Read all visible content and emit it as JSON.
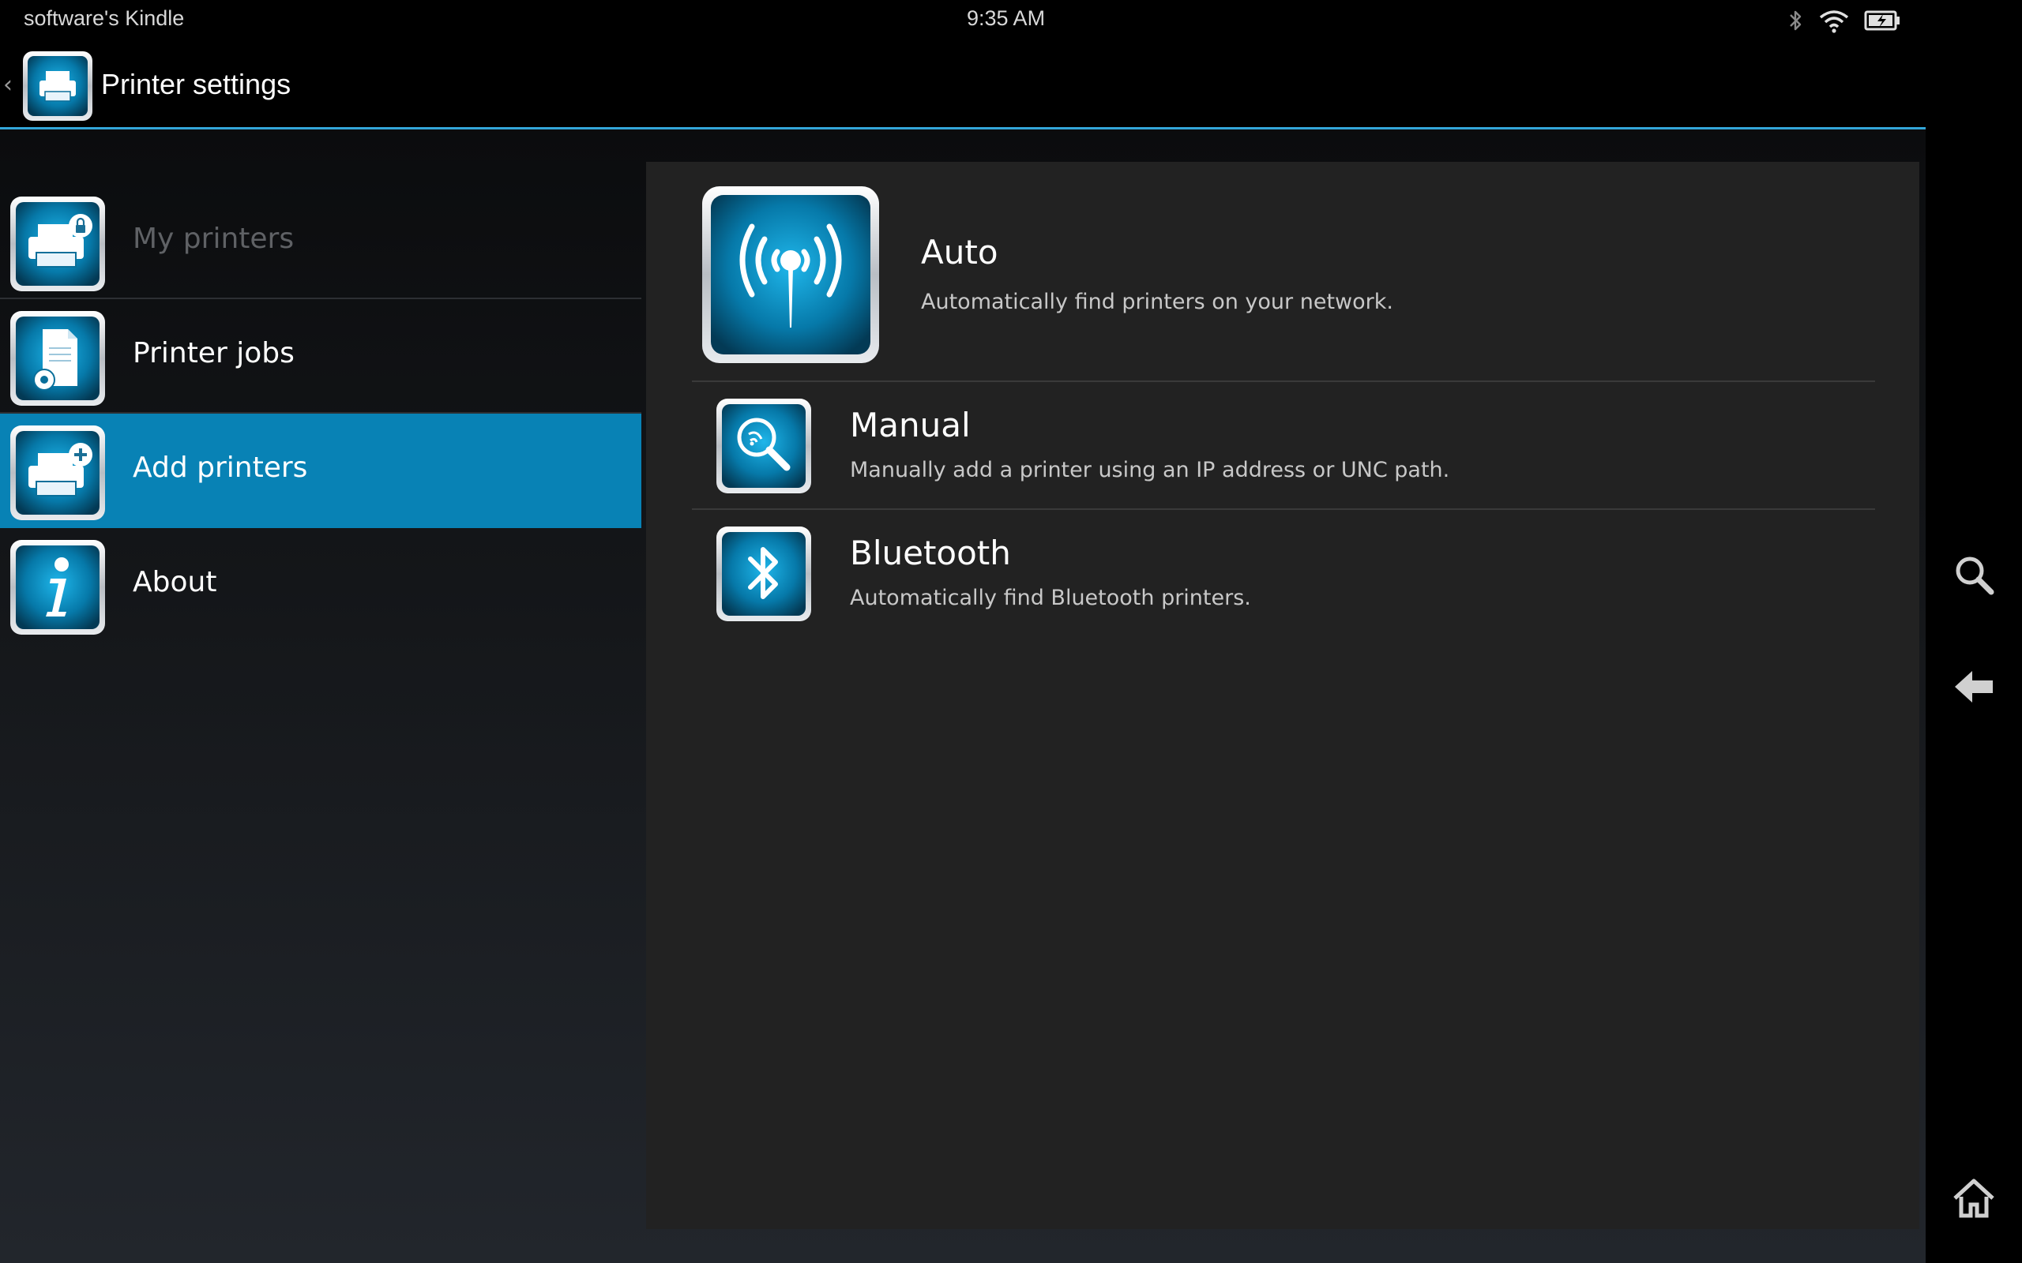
{
  "status_bar": {
    "device_name": "software's Kindle",
    "time": "9:35 AM",
    "icons": [
      "bluetooth-icon",
      "wifi-icon",
      "battery-icon"
    ]
  },
  "action_bar": {
    "up_caret": "‹",
    "title": "Printer settings",
    "icon": "printer-icon"
  },
  "sidebar": {
    "items": [
      {
        "label": "My printers",
        "icon": "printer-lock-icon",
        "state": "disabled"
      },
      {
        "label": "Printer jobs",
        "icon": "document-gear-icon",
        "state": "normal"
      },
      {
        "label": "Add printers",
        "icon": "printer-add-icon",
        "state": "selected"
      },
      {
        "label": "About",
        "icon": "info-icon",
        "state": "normal"
      }
    ]
  },
  "options": [
    {
      "title": "Auto",
      "description": "Automatically find printers on your network.",
      "icon": "wireless-antenna-icon"
    },
    {
      "title": "Manual",
      "description": "Manually add a printer using an IP address or UNC path.",
      "icon": "search-network-icon"
    },
    {
      "title": "Bluetooth",
      "description": "Automatically find Bluetooth printers.",
      "icon": "bluetooth-icon"
    }
  ],
  "system_nav": [
    "search-icon",
    "back-icon",
    "home-icon"
  ],
  "colors": {
    "accent": "#33a6d9",
    "selected": "#0882b5",
    "panel": "#222222"
  }
}
